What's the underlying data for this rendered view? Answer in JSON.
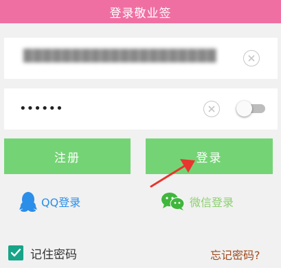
{
  "header": {
    "title": "登录敬业签"
  },
  "account_field": {
    "value": "████████████████████"
  },
  "password_field": {
    "value": "••••••"
  },
  "buttons": {
    "register": "注册",
    "login": "登录"
  },
  "social": {
    "qq": "QQ登录",
    "wechat": "微信登录"
  },
  "remember": {
    "label": "记住密码",
    "checked": true
  },
  "forgot": {
    "label": "忘记密码?"
  },
  "colors": {
    "header": "#f06fa3",
    "button": "#74d475",
    "qq": "#2b8ee9",
    "wechat": "#8ccf6e",
    "checkbox": "#18a488",
    "arrow": "#e8352d",
    "forgot": "#a04a1c"
  },
  "icons": {
    "clear": "clear-circle-icon",
    "qq": "qq-penguin-icon",
    "wechat": "wechat-bubbles-icon",
    "check": "checkmark-icon"
  }
}
